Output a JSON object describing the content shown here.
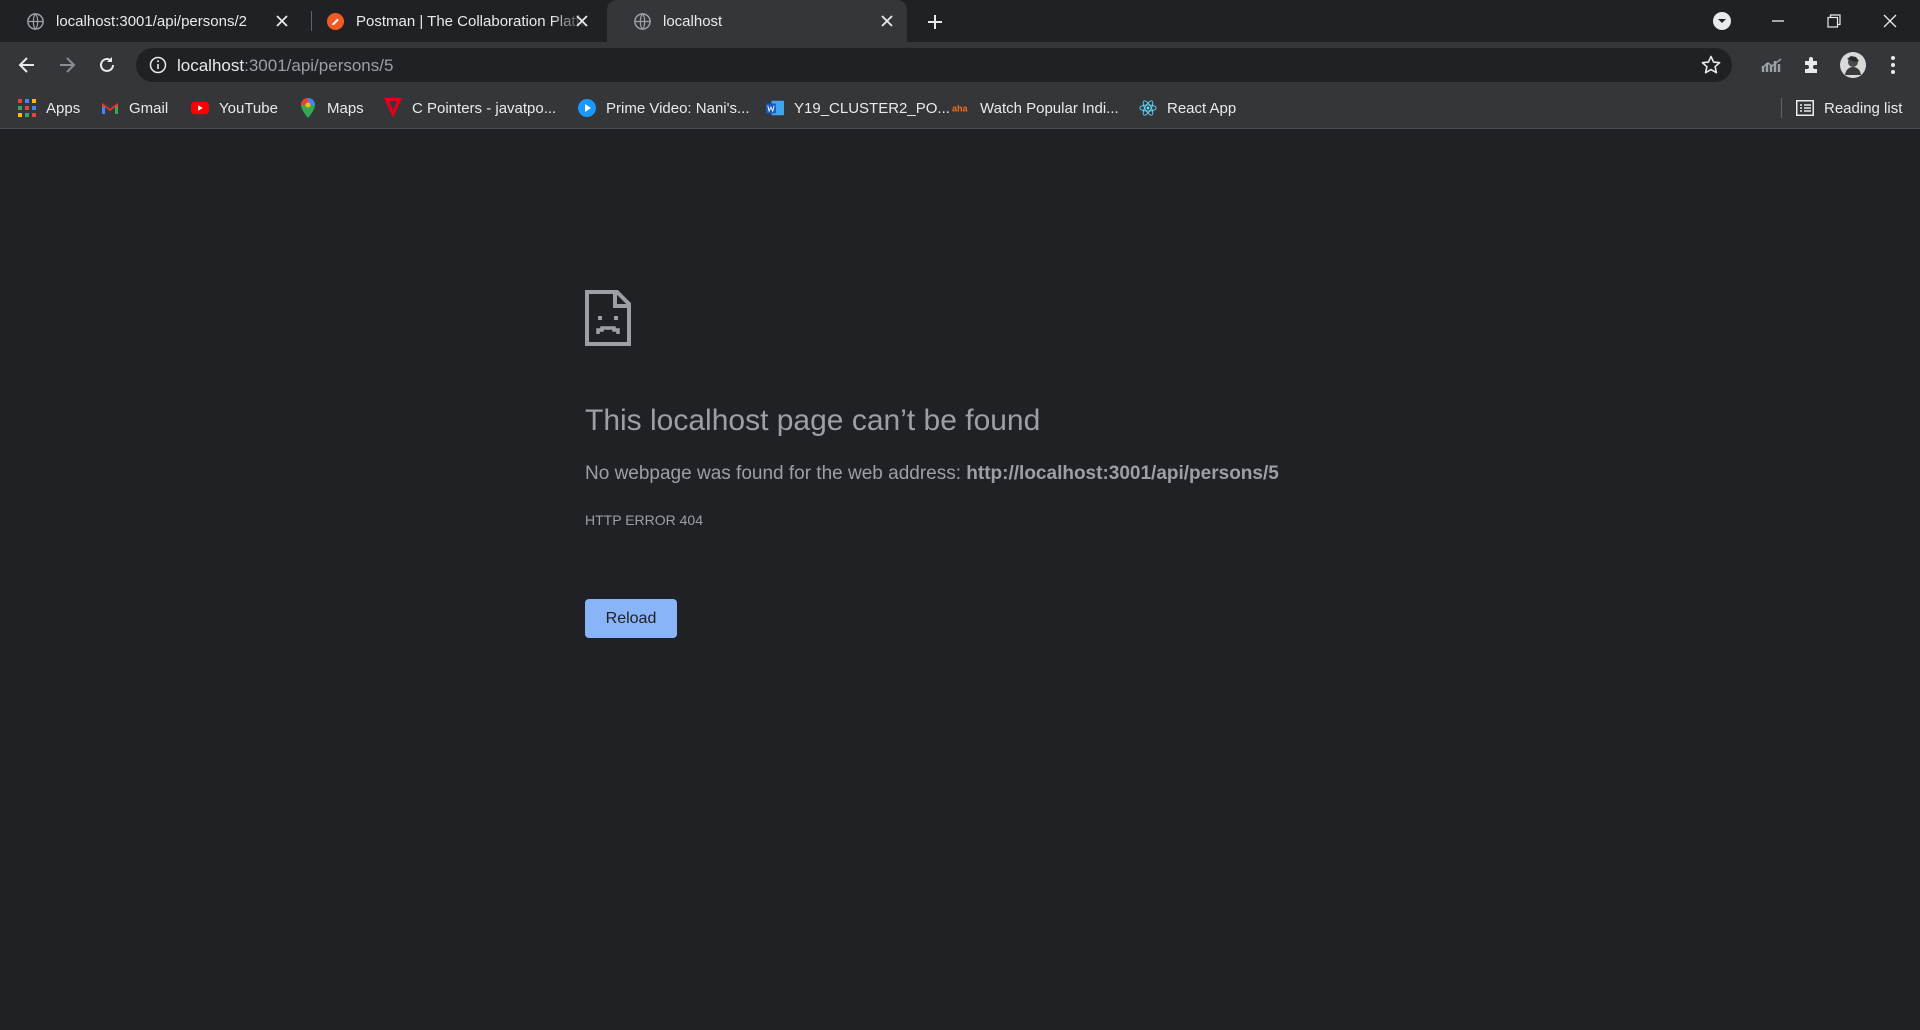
{
  "tabs": [
    {
      "title": "localhost:3001/api/persons/2",
      "icon": "globe-icon"
    },
    {
      "title": "Postman | The Collaboration Platform for API Development",
      "icon": "postman-icon"
    },
    {
      "title": "localhost",
      "icon": "globe-icon",
      "active": true
    }
  ],
  "address_bar": {
    "host": "localhost",
    "path": ":3001/api/persons/5"
  },
  "bookmarks": [
    {
      "label": "Apps",
      "icon": "apps-grid-icon"
    },
    {
      "label": "Gmail",
      "icon": "gmail-icon"
    },
    {
      "label": "YouTube",
      "icon": "youtube-icon"
    },
    {
      "label": "Maps",
      "icon": "maps-pin-icon"
    },
    {
      "label": "C Pointers - javatpo...",
      "icon": "javatpoint-icon"
    },
    {
      "label": "Prime Video: Nani's...",
      "icon": "prime-video-icon"
    },
    {
      "label": "Y19_CLUSTER2_PO...",
      "icon": "word-doc-icon"
    },
    {
      "label": "Watch Popular Indi...",
      "icon": "aha-icon"
    },
    {
      "label": "React App",
      "icon": "react-icon"
    }
  ],
  "reading_list": "Reading list",
  "error": {
    "title": "This localhost page can’t be found",
    "description_prefix": "No webpage was found for the web address: ",
    "url": "http://localhost:3001/api/persons/5",
    "code": "HTTP ERROR 404",
    "reload_label": "Reload"
  },
  "colors": {
    "page_bg": "#202124",
    "toolbar_bg": "#35363a",
    "accent": "#8ab4f8",
    "muted_text": "#9aa0a6"
  }
}
